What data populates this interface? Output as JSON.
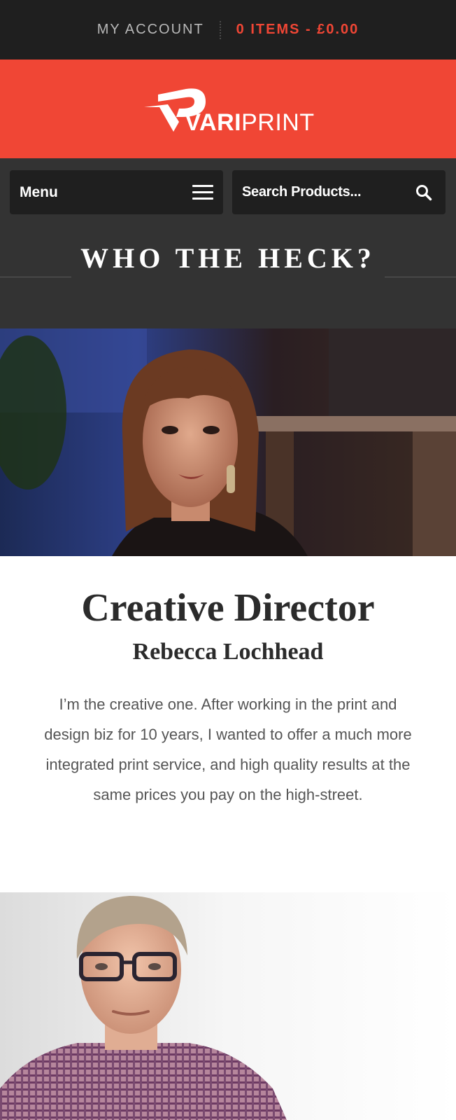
{
  "topbar": {
    "account_label": "MY ACCOUNT",
    "cart_label": "0 ITEMS - £0.00"
  },
  "brand": {
    "name_bold": "VARI",
    "name_light": "PRINT",
    "color": "#f04635"
  },
  "nav": {
    "menu_label": "Menu",
    "search_placeholder": "Search Products..."
  },
  "page": {
    "title": "WHO THE HECK?"
  },
  "team": [
    {
      "role": "Creative Director",
      "name": "Rebecca Lochhead",
      "bio": "I’m the creative one. After working in the print and design biz for 10 years, I wanted to offer a much more integrated print service, and high quality results at the same prices you pay on the high-street."
    }
  ],
  "colors": {
    "topbar_bg": "#1f1f1f",
    "brand_red": "#f04635",
    "nav_bg": "#333333",
    "button_bg": "#1f1f1f"
  },
  "icons": [
    "hamburger-icon",
    "search-icon"
  ]
}
